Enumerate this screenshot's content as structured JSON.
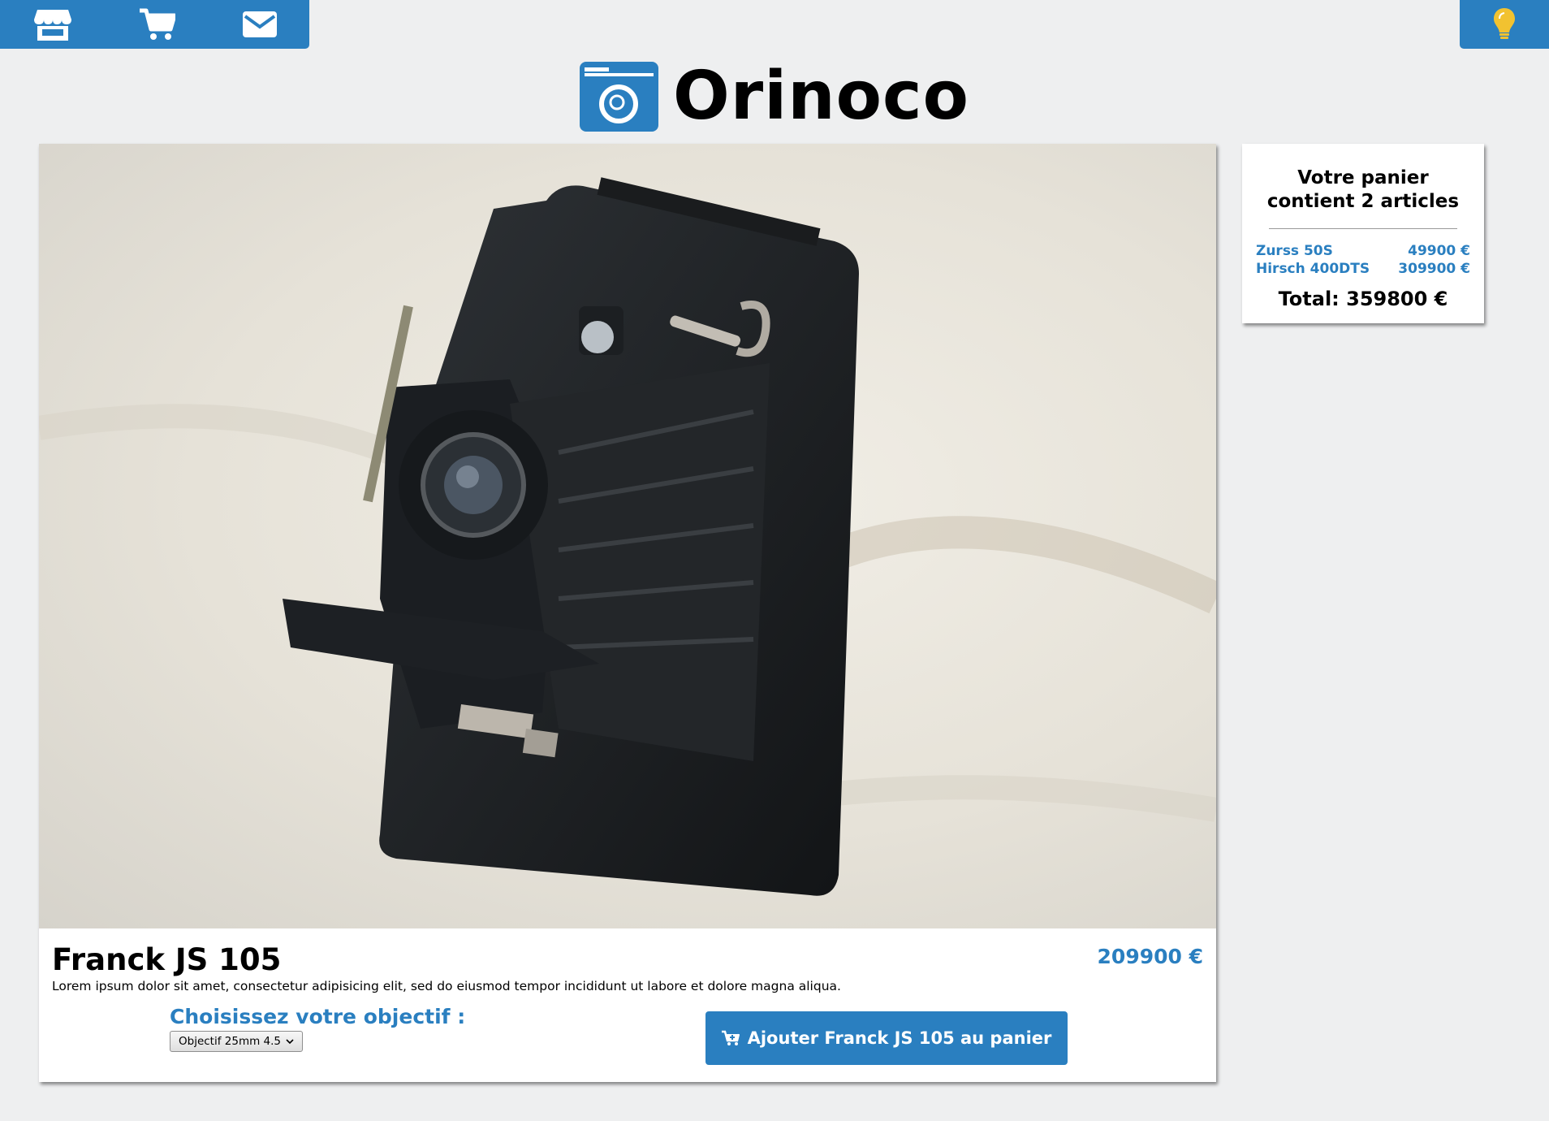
{
  "nav": {
    "items": [
      {
        "icon": "store-icon"
      },
      {
        "icon": "cart-icon"
      },
      {
        "icon": "envelope-icon"
      }
    ],
    "theme_toggle_icon": "lightbulb-icon"
  },
  "header": {
    "brand": "Orinoco",
    "logo_icon": "camera-icon"
  },
  "product": {
    "name": "Franck JS 105",
    "price": "209900 €",
    "description": "Lorem ipsum dolor sit amet, consectetur adipisicing elit, sed do eiusmod tempor incididunt ut labore et dolore magna aliqua.",
    "lens_label": "Choisissez votre objectif :",
    "lens_selected": "Objectif 25mm 4.5",
    "add_button_label": "Ajouter Franck JS 105 au panier",
    "image_alt": "vintage folding camera"
  },
  "cart": {
    "title": "Votre panier contient 2 articles",
    "items": [
      {
        "name": "Zurss 50S",
        "price": "49900 €"
      },
      {
        "name": "Hirsch 400DTS",
        "price": "309900 €"
      }
    ],
    "total": "Total: 359800 €"
  },
  "colors": {
    "accent": "#2a7fc0",
    "background": "#eeeff0",
    "bulb": "#f2c230"
  }
}
